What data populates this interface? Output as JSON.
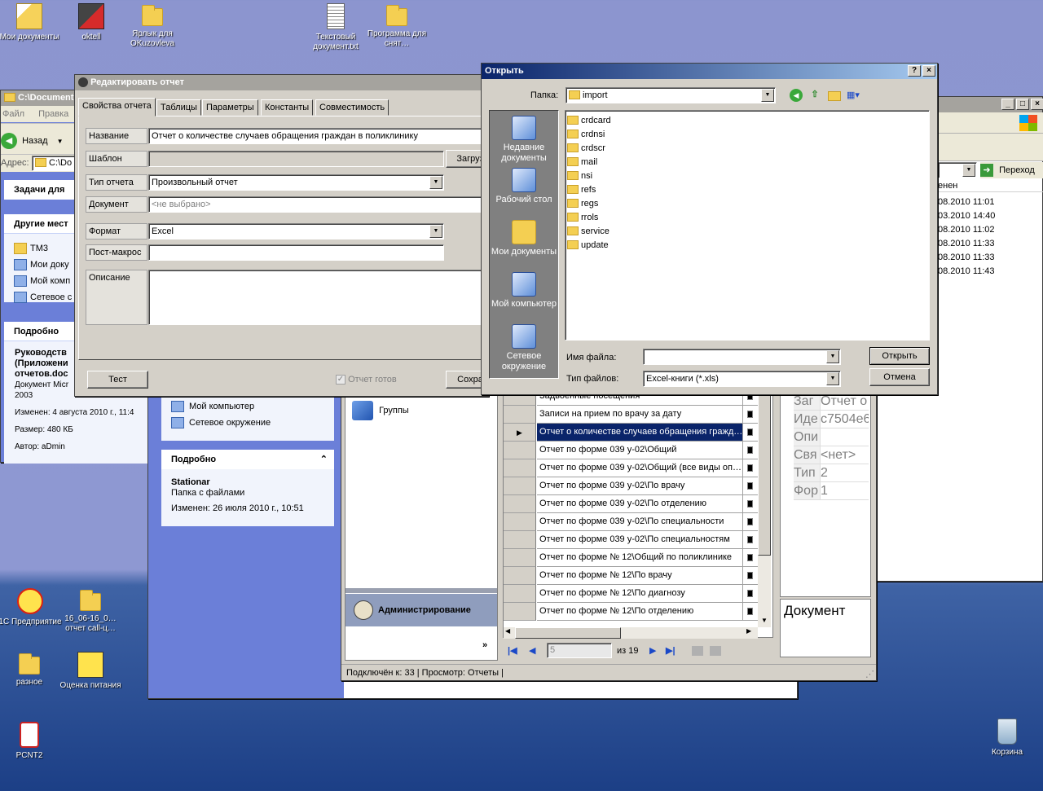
{
  "desktop": {
    "icons_top": [
      "Мои документы",
      "oktell",
      "Ярлык для OKuzovleva",
      "Текстовый документ.txt",
      "Программа для снят…"
    ],
    "icons_bottom": [
      "1С Предприятие",
      "16_06-16_0… отчет call-ц…",
      "разное",
      "Оценка питания",
      "PCNT2",
      "Корзина"
    ]
  },
  "explorer_left": {
    "title": "C:\\Documents",
    "menu": [
      "Файл",
      "Правка"
    ],
    "back": "Назад",
    "address_label": "Адрес:",
    "address_value": "C:\\Do",
    "tasks_header": "Задачи для",
    "other_header": "Другие мест",
    "places": [
      "TM3",
      "Мои доку",
      "Мой комп",
      "Сетевое с"
    ],
    "details_header": "Подробно",
    "doc_title": "Руководств (Приложени отчетов.doc",
    "doc_type": "Документ Micr 2003",
    "modified": "Изменен: 4 августа 2010 г., 11:4",
    "size": "Размер: 480 КБ",
    "author": "Автор: aDmin"
  },
  "explorer_right": {
    "go_label": "Переход",
    "col_header": "енен",
    "dates": [
      "08.2010 11:01",
      "03.2010 14:40",
      "08.2010 11:02",
      "08.2010 11:33",
      "08.2010 11:33",
      "08.2010 11:43"
    ]
  },
  "explorer_mid": {
    "places": [
      "Мой компьютер",
      "Сетевое окружение"
    ],
    "details_header": "Подробно",
    "item_name": "Stationar",
    "item_type": "Папка с файлами",
    "item_modified": "Изменен: 26 июля 2010 г., 10:51"
  },
  "app": {
    "groups_label": "Группы",
    "admin_label": "Администрирование",
    "status": "Подключён к: 33  | Просмотр: Отчеты |",
    "reports": [
      "Задвоенные посещения",
      "Записи на прием по врачу за дату",
      "Отчет о количестве случаев обращения гражд…",
      "Отчет по форме 039 у-02\\Общий",
      "Отчет по форме 039 у-02\\Общий (все виды оп…",
      "Отчет по форме 039 у-02\\По врачу",
      "Отчет по форме 039 у-02\\По отделению",
      "Отчет по форме 039 у-02\\По специальности",
      "Отчет по форме 039 у-02\\По специальностям",
      "Отчет по форме № 12\\Общий по поликлинике",
      "Отчет по форме № 12\\По врачу",
      "Отчет по форме № 12\\По диагнозу",
      "Отчет по форме № 12\\По отделению"
    ],
    "selected_index": 2,
    "pager_page": "5",
    "pager_of": "из 19",
    "props_labels": [
      "Заг",
      "Иде",
      "Опи",
      "Свя",
      "Тип",
      "Фор"
    ],
    "props_values": [
      "Отчет о",
      "c7504e6",
      "",
      "<нет>",
      "2",
      "1"
    ],
    "doc_panel": "Документ"
  },
  "edit_dialog": {
    "title": "Редактировать отчет",
    "tabs": [
      "Свойства отчета",
      "Таблицы",
      "Параметры",
      "Константы",
      "Совместимость"
    ],
    "name_label": "Название",
    "name_value": "Отчет о количестве случаев обращения граждан в поликлинику",
    "template_label": "Шаблон",
    "load_button": "Загруз",
    "type_label": "Тип отчета",
    "type_value": "Произвольный отчет",
    "document_label": "Документ",
    "document_value": "<не выбрано>",
    "format_label": "Формат",
    "format_value": "Excel",
    "postmacro_label": "Пост-макрос",
    "postmacro_value": "",
    "description_label": "Описание",
    "description_value": "",
    "test_button": "Тест",
    "ready_label": "Отчет готов",
    "save_button": "Сохра"
  },
  "open_dialog": {
    "title": "Открыть",
    "lookin_label": "Папка:",
    "lookin_value": "import",
    "places": [
      "Недавние документы",
      "Рабочий стол",
      "Мои документы",
      "Мой компьютер",
      "Сетевое окружение"
    ],
    "folders": [
      "crdcard",
      "crdnsi",
      "crdscr",
      "mail",
      "nsi",
      "refs",
      "regs",
      "rrols",
      "service",
      "update"
    ],
    "filename_label": "Имя файла:",
    "filename_value": "",
    "filetype_label": "Тип файлов:",
    "filetype_value": "Excel-книги (*.xls)",
    "open_button": "Открыть",
    "cancel_button": "Отмена"
  }
}
